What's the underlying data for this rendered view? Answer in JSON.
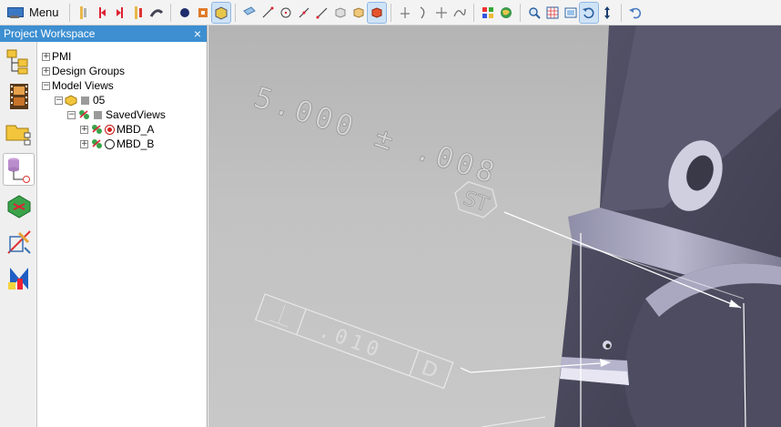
{
  "toolbar": {
    "menu_label": "Menu",
    "tools": [
      "wireframe-icon",
      "mark-left-icon",
      "mark-right-icon",
      "mark-both-icon",
      "pen-icon",
      "sphere-icon",
      "part-icon",
      "shaded-part-icon",
      "sketch-icon",
      "line-icon",
      "circle-icon",
      "diagonal-line-icon",
      "diagonal-line-2-icon",
      "box-icon",
      "cube-icon",
      "solid-cube-icon",
      "axis-icon",
      "curve-icon",
      "cross-axis-icon",
      "spline-icon",
      "palette-icon",
      "globe-icon",
      "zoom-icon",
      "grid-icon",
      "view-icon",
      "rotate-icon",
      "pan-vertical-icon",
      "undo-icon"
    ]
  },
  "workspace": {
    "title": "Project Workspace",
    "close": "×",
    "side_icons": [
      "project-tree-icon",
      "film-strip-icon",
      "folder-structure-icon",
      "database-icon",
      "assembly-icon",
      "drafting-icon",
      "mirror-icon"
    ],
    "tree": {
      "pmi": "PMI",
      "design_groups": "Design Groups",
      "model_views": "Model Views",
      "view_05": "05",
      "saved_views": "SavedViews",
      "mbd_a": "MBD_A",
      "mbd_b": "MBD_B"
    }
  },
  "viewport": {
    "dimension_text": "5.000 ± .008",
    "dimension_flag": "ST",
    "tolerance_value": ".010",
    "datum": "D",
    "gdt_symbol": "⏊"
  },
  "colors": {
    "title_bar": "#3d8fd1",
    "part_face": "#4b4b5c",
    "viewport_bg": "#c0c0c0"
  }
}
